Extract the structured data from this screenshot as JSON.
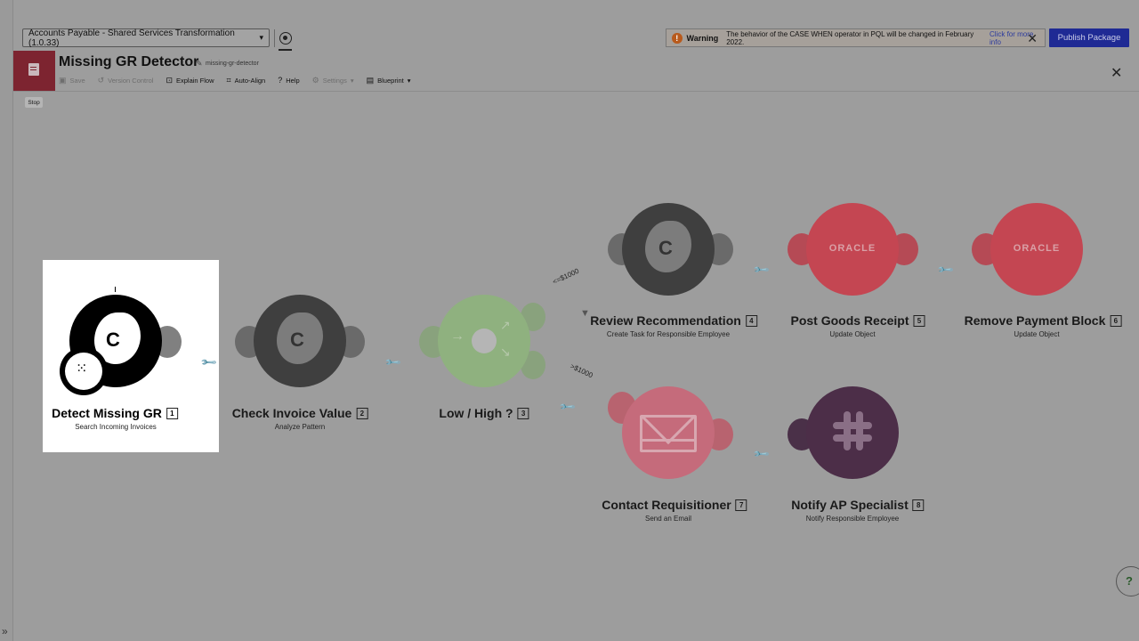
{
  "topbar": {
    "package_select": "Accounts Payable - Shared Services Transformation (1.0.33)",
    "warning_title": "Warning",
    "warning_text": "The behavior of the CASE WHEN operator in PQL will be changed in February 2022.",
    "warning_link": "Click for more info",
    "publish_label": "Publish Package"
  },
  "header": {
    "title": "Missing GR Detector",
    "slug": "missing-gr-detector",
    "stop_tooltip": "Stop"
  },
  "toolbar": {
    "save": "Save",
    "version_control": "Version Control",
    "explain_flow": "Explain Flow",
    "auto_align": "Auto-Align",
    "help": "Help",
    "settings": "Settings",
    "blueprint": "Blueprint"
  },
  "colors": {
    "brand_tile": "#7d2430",
    "publish": "#1f2a94",
    "oracle_red": "#c44652",
    "email_pink": "#c56b7b",
    "slack_purple": "#4c2e48",
    "router_green": "#8fb17f"
  },
  "nodes": [
    {
      "num": "1",
      "title": "Detect Missing GR",
      "subtitle": "Search Incoming Invoices",
      "icon": "celonis-icon"
    },
    {
      "num": "2",
      "title": "Check Invoice Value",
      "subtitle": "Analyze Pattern",
      "icon": "celonis-icon"
    },
    {
      "num": "3",
      "title": "Low / High ?",
      "subtitle": "",
      "icon": "router-icon"
    },
    {
      "num": "4",
      "title": "Review Recommendation",
      "subtitle": "Create Task for Responsible Employee",
      "icon": "celonis-icon"
    },
    {
      "num": "5",
      "title": "Post Goods Receipt",
      "subtitle": "Update Object",
      "icon": "oracle-icon"
    },
    {
      "num": "6",
      "title": "Remove Payment Block",
      "subtitle": "Update Object",
      "icon": "oracle-icon"
    },
    {
      "num": "7",
      "title": "Contact Requisitioner",
      "subtitle": "Send an Email",
      "icon": "email-icon"
    },
    {
      "num": "8",
      "title": "Notify AP Specialist",
      "subtitle": "Notify Responsible Employee",
      "icon": "slack-icon"
    }
  ],
  "node_text": {
    "oracle": "ORACLE",
    "c": "C"
  },
  "edges": {
    "low": "<=$1000",
    "high": ">$1000"
  }
}
